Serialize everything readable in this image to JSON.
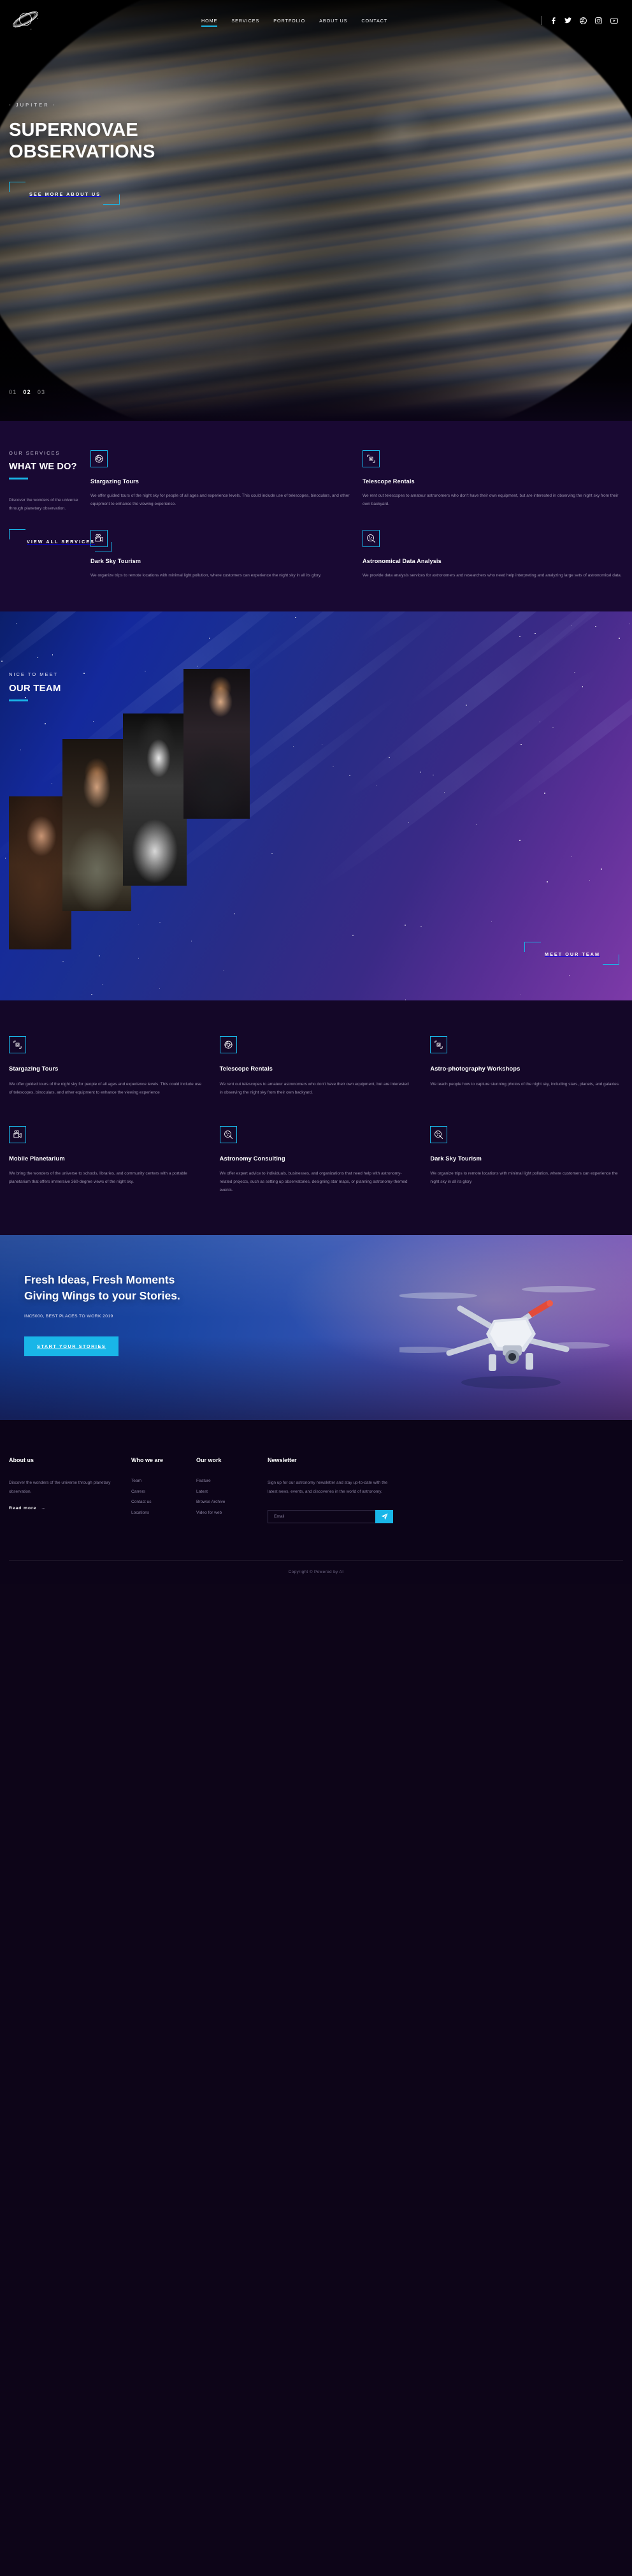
{
  "brand": {
    "logo_icon": "saturn-planet-icon"
  },
  "nav": {
    "items": [
      {
        "label": "HOME",
        "active": true
      },
      {
        "label": "SERVICES",
        "active": false
      },
      {
        "label": "PORTFOLIO",
        "active": false
      },
      {
        "label": "ABOUT US",
        "active": false
      },
      {
        "label": "CONTACT",
        "active": false
      }
    ],
    "socials": [
      "facebook-icon",
      "twitter-icon",
      "dribbble-icon",
      "instagram-icon",
      "youtube-icon"
    ]
  },
  "hero": {
    "eyebrow": "-  JUPITER  -",
    "title_line1": "SUPERNOVAE",
    "title_line2": "OBSERVATIONS",
    "cta": "SEE MORE ABOUT US",
    "slides": [
      "01",
      "02",
      "03"
    ],
    "active_slide": "02"
  },
  "services": {
    "kicker": "OUR SERVICES",
    "title": "WHAT WE DO?",
    "description": "Discover the wonders of the universe through planetary observation.",
    "cta": "VIEW ALL SERVICES",
    "cards": [
      {
        "icon": "telescope-lens-icon",
        "title": "Stargazing Tours",
        "body": "We offer guided tours of the night sky for people of all ages and experience levels. This could include use of telescopes, binoculars, and other equipment to enhance the viewing experience."
      },
      {
        "icon": "telescope-frame-icon",
        "title": "Telescope Rentals",
        "body": "We rent out telescopes to amateur astronomers who don't have their own equipment, but are interested in observing the night sky from their own backyard."
      },
      {
        "icon": "film-camera-icon",
        "title": "Dark Sky Tourism",
        "body": "We organize trips to remote locations with minimal light pollution, where customers can experience the night sky in all its glory."
      },
      {
        "icon": "data-search-icon",
        "title": "Astronomical Data Analysis",
        "body": "We provide data analysis services for astronomers and researchers who need help interpreting and analyzing large sets of astronomical data."
      }
    ]
  },
  "team": {
    "kicker": "NICE TO MEET",
    "title": "OUR TEAM",
    "cta": "MEET OUR TEAM",
    "members": [
      {
        "photo": "portrait-woman-curly-hair"
      },
      {
        "photo": "portrait-man-beard"
      },
      {
        "photo": "portrait-woman-bw-glam"
      },
      {
        "photo": "portrait-man-leather-jacket"
      }
    ]
  },
  "services2": {
    "cards": [
      {
        "icon": "telescope-frame-icon",
        "title": "Stargazing Tours",
        "body": "We offer guided tours of the night sky for people of all ages and experience levels. This could include use of telescopes, binoculars, and other equipment to enhance the viewing experience"
      },
      {
        "icon": "telescope-lens-icon",
        "title": "Telescope Rentals",
        "body": "We rent out telescopes to amateur astronomers who don't have their own equipment, but are interested in observing the night sky from their own backyard."
      },
      {
        "icon": "telescope-frame-icon",
        "title": "Astro-photography Workshops",
        "body": "We teach people how to capture stunning photos of the night sky, including stars, planets, and galaxies"
      },
      {
        "icon": "film-camera-icon",
        "title": "Mobile Planetarium",
        "body": "We bring the wonders of the universe to schools, libraries, and community centers with a portable planetarium that offers immersive 360-degree views of the night sky."
      },
      {
        "icon": "data-search-icon",
        "title": "Astronomy Consulting",
        "body": "We offer expert advice to individuals, businesses, and organizations that need help with astronomy-related projects, such as setting up observatories, designing star maps, or planning astronomy-themed events."
      },
      {
        "icon": "data-search-icon",
        "title": "Dark Sky Tourism",
        "body": "We organize trips to remote locations with minimal light pollution, where customers can experience the night sky in all its glory"
      }
    ]
  },
  "cta_banner": {
    "title_line1": "Fresh Ideas, Fresh Moments",
    "title_line2": "Giving Wings to your Stories.",
    "subtitle": "INC5000, BEST PLACES TO WORK 2019",
    "button": "START YOUR STORIES",
    "image": "drone-quadcopter"
  },
  "footer": {
    "about": {
      "heading": "About us",
      "text": "Discover the wonders of the universe through planetary observation.",
      "read_more": "Read more",
      "arrow": "→"
    },
    "who": {
      "heading": "Who we are",
      "links": [
        "Team",
        "Carrers",
        "Contact us",
        "Locations"
      ]
    },
    "work": {
      "heading": "Our work",
      "links": [
        "Feature",
        "Latest",
        "Browse Archive",
        "Video for web"
      ]
    },
    "newsletter": {
      "heading": "Newsletter",
      "text": "Sign up for our astronomy newsletter and stay up-to-date with the latest news, events, and discoveries in the world of astronomy.",
      "placeholder": "Email",
      "submit_icon": "send-paper-plane-icon"
    },
    "copyright": "Copyright © Powered by AI"
  },
  "colors": {
    "accent": "#19b6e8",
    "services_bg": "#190933",
    "grid2_bg": "#140728",
    "footer_bg": "#0c0418"
  }
}
